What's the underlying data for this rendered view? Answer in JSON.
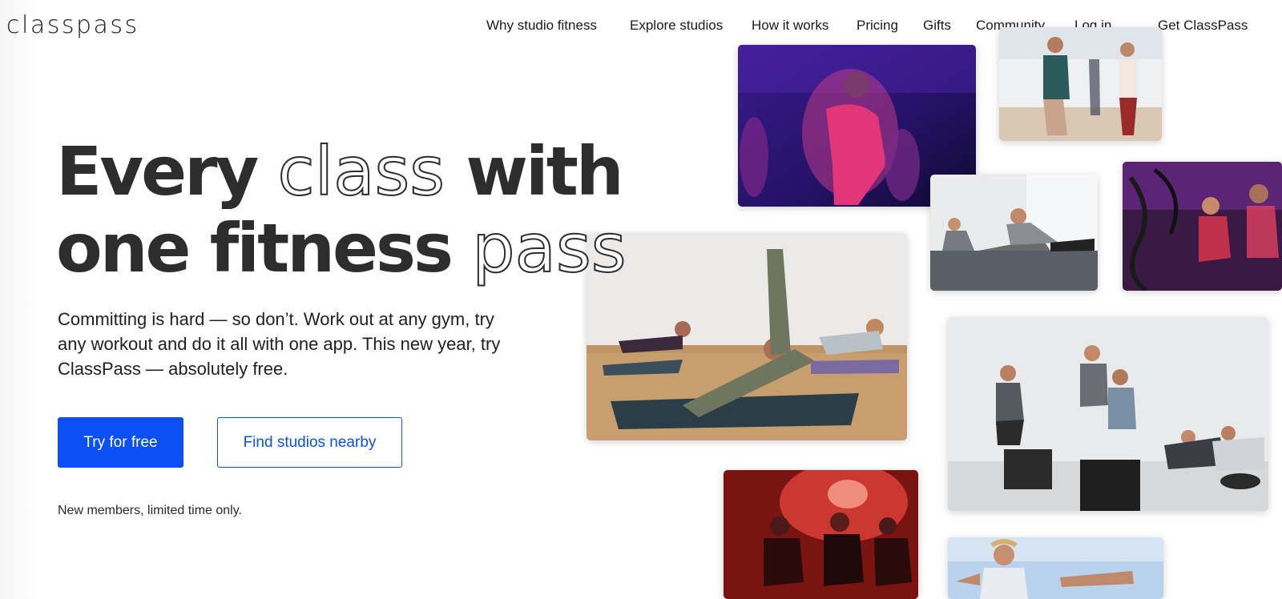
{
  "logo": "classpass",
  "nav": {
    "items": [
      {
        "label": "Why studio fitness",
        "id": "why-studio-fitness"
      },
      {
        "label": "Explore studios",
        "id": "explore-studios"
      },
      {
        "label": "How it works",
        "id": "how-it-works"
      },
      {
        "label": "Pricing",
        "id": "pricing"
      },
      {
        "label": "Gifts",
        "id": "gifts"
      },
      {
        "label": "Community",
        "id": "community"
      },
      {
        "label": "Log in",
        "id": "log-in"
      },
      {
        "label": "Get ClassPass",
        "id": "get-classpass"
      }
    ]
  },
  "hero": {
    "headline": {
      "part1": "Every ",
      "part2_outline": "class",
      "part3": " with",
      "line2_part1": "one fitness ",
      "line2_part2_outline": "pass"
    },
    "subtitle": "Committing is hard — so don’t. Work out at any gym, try any workout and do it all with one app. This new year, try ClassPass — absolutely free.",
    "primary_button": "Try for free",
    "secondary_button": "Find studios nearby",
    "note": "New members, limited time only."
  },
  "photos": [
    {
      "name": "cycling-photo-purple",
      "subject": "cycling class in purple light"
    },
    {
      "name": "yoga-tree-pose-photo",
      "subject": "tree pose yoga class"
    },
    {
      "name": "plank-workout-photo",
      "subject": "plank workout"
    },
    {
      "name": "battle-ropes-photo",
      "subject": "battle ropes class"
    },
    {
      "name": "side-plank-yoga-photo",
      "subject": "side plank yoga"
    },
    {
      "name": "box-jump-photo",
      "subject": "box jump training"
    },
    {
      "name": "red-cycling-photo",
      "subject": "red light spin class"
    },
    {
      "name": "outdoor-workout-photo",
      "subject": "outdoor workout"
    }
  ],
  "colors": {
    "accent": "#0b4ff5",
    "text": "#2d2d2d"
  }
}
